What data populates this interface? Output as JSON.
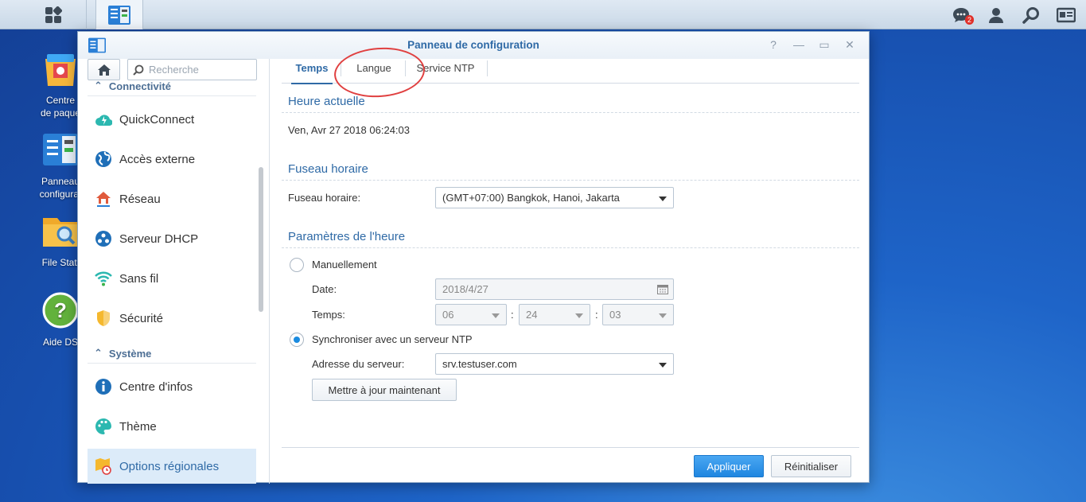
{
  "window": {
    "title": "Panneau de configuration"
  },
  "taskbar": {
    "notification_count": "2"
  },
  "desktop": {
    "icons": [
      {
        "label": "Centre\nde paque",
        "icon": "package-center-icon"
      },
      {
        "label": "Panneau\nconfigurat",
        "icon": "control-panel-icon"
      },
      {
        "label": "File Stati",
        "icon": "file-station-icon"
      },
      {
        "label": "Aide DS",
        "icon": "help-icon"
      }
    ]
  },
  "sidebar": {
    "search_placeholder": "Recherche",
    "section_connectivity": "Connectivité",
    "section_system": "Système",
    "items": [
      {
        "label": "QuickConnect",
        "icon": "quickconnect-icon"
      },
      {
        "label": "Accès externe",
        "icon": "globe-icon"
      },
      {
        "label": "Réseau",
        "icon": "network-house-icon"
      },
      {
        "label": "Serveur DHCP",
        "icon": "dhcp-icon"
      },
      {
        "label": "Sans fil",
        "icon": "wifi-icon"
      },
      {
        "label": "Sécurité",
        "icon": "shield-icon"
      },
      {
        "label": "Centre d'infos",
        "icon": "info-icon"
      },
      {
        "label": "Thème",
        "icon": "palette-icon"
      },
      {
        "label": "Options régionales",
        "icon": "regional-options-icon"
      }
    ]
  },
  "tabs": [
    {
      "label": "Temps"
    },
    {
      "label": "Langue"
    },
    {
      "label": "Service NTP"
    }
  ],
  "current_time": {
    "title": "Heure actuelle",
    "value": "Ven, Avr 27 2018 06:24:03"
  },
  "timezone": {
    "title": "Fuseau horaire",
    "label": "Fuseau horaire:",
    "value": "(GMT+07:00) Bangkok, Hanoi, Jakarta"
  },
  "time_settings": {
    "title": "Paramètres de l'heure",
    "manual_label": "Manuellement",
    "date_label": "Date:",
    "date_value": "2018/4/27",
    "time_label": "Temps:",
    "hour": "06",
    "minute": "24",
    "second": "03",
    "sep": ":",
    "ntp_label": "Synchroniser avec un serveur NTP",
    "server_label": "Adresse du serveur:",
    "server_value": "srv.testuser.com",
    "update_button": "Mettre à jour maintenant"
  },
  "footer": {
    "apply": "Appliquer",
    "reset": "Réinitialiser"
  },
  "colors": {
    "accent": "#2f6aa6",
    "primary_button": "#1f86e0",
    "highlight_circle": "#e04040"
  }
}
